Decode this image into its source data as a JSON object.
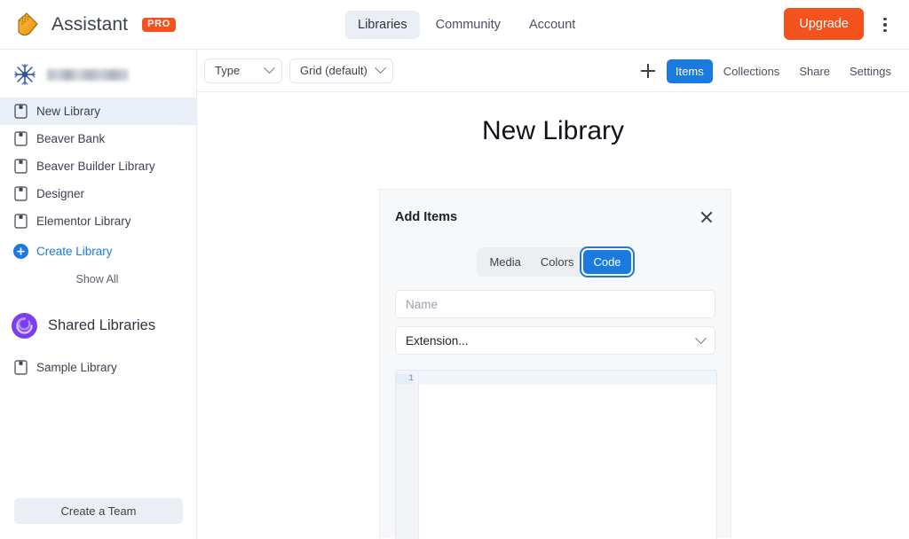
{
  "topbar": {
    "logo_icon": "assistant-logo-icon",
    "brand": "Assistant",
    "pro_badge": "PRO",
    "nav": [
      {
        "label": "Libraries",
        "active": true
      },
      {
        "label": "Community",
        "active": false
      },
      {
        "label": "Account",
        "active": false
      }
    ],
    "upgrade_label": "Upgrade",
    "kebab_icon": "more-vertical-icon"
  },
  "sidebar": {
    "account": {
      "avatar_icon": "snowflake-avatar-icon",
      "name": ""
    },
    "libraries": [
      {
        "label": "New Library",
        "icon": "book-icon",
        "active": true
      },
      {
        "label": "Beaver Bank",
        "icon": "book-icon",
        "active": false
      },
      {
        "label": "Beaver Builder Library",
        "icon": "book-icon",
        "active": false
      },
      {
        "label": "Designer",
        "icon": "book-icon",
        "active": false
      },
      {
        "label": "Elementor Library",
        "icon": "book-icon",
        "active": false
      }
    ],
    "create_library": {
      "label": "Create Library",
      "icon": "plus-circle-icon"
    },
    "show_all": "Show All",
    "shared": {
      "label": "Shared Libraries",
      "icon": "shared-libraries-icon"
    },
    "shared_items": [
      {
        "label": "Sample Library",
        "icon": "book-icon"
      }
    ],
    "create_team": "Create a Team"
  },
  "toolbar": {
    "type_filter": {
      "label": "Type",
      "icon": "chevron-down-icon"
    },
    "sort_filter": {
      "label": "Grid (default)",
      "icon": "chevron-down-icon"
    },
    "add_icon": "plus-icon",
    "tabs": [
      {
        "label": "Items",
        "active": true
      },
      {
        "label": "Collections",
        "active": false
      },
      {
        "label": "Share",
        "active": false
      },
      {
        "label": "Settings",
        "active": false
      }
    ]
  },
  "main": {
    "title": "New Library"
  },
  "panel": {
    "title": "Add Items",
    "close_icon": "close-icon",
    "segments": [
      {
        "label": "Media",
        "active": false
      },
      {
        "label": "Colors",
        "active": false
      },
      {
        "label": "Code",
        "active": true
      }
    ],
    "name_field": {
      "value": "",
      "placeholder": "Name"
    },
    "extension_field": {
      "value": "Extension...",
      "icon": "chevron-down-icon"
    },
    "editor": {
      "line_number": "1",
      "content": ""
    }
  },
  "colors": {
    "accent_blue": "#1a7ae0",
    "brand_orange": "#f4531f",
    "panel_bg": "#f7f8fa",
    "active_nav_bg": "#e9eff6"
  }
}
